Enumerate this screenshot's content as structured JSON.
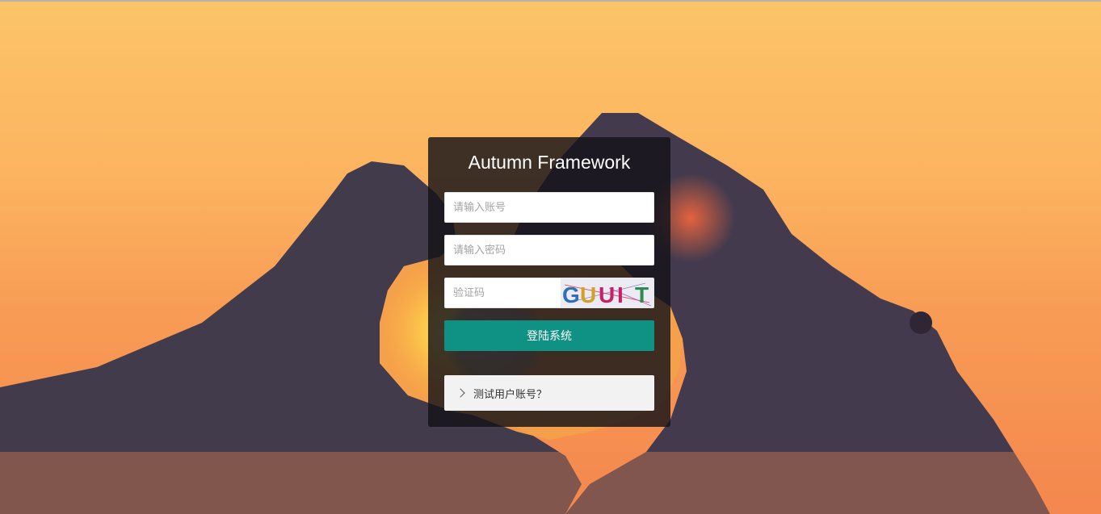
{
  "login": {
    "title": "Autumn Framework",
    "account_placeholder": "请输入账号",
    "password_placeholder": "请输入密码",
    "captcha_placeholder": "验证码",
    "captcha_text": "GUUI T",
    "submit_label": "登陆系统",
    "test_accounts_label": "测试用户账号？"
  },
  "colors": {
    "primary_button": "#0f9284",
    "panel_bg": "rgba(20,18,24,0.82)",
    "sky_top": "#fcc468",
    "sky_bottom": "#f4874d"
  },
  "icons": {
    "test_accounts": "chevron-right-icon"
  }
}
